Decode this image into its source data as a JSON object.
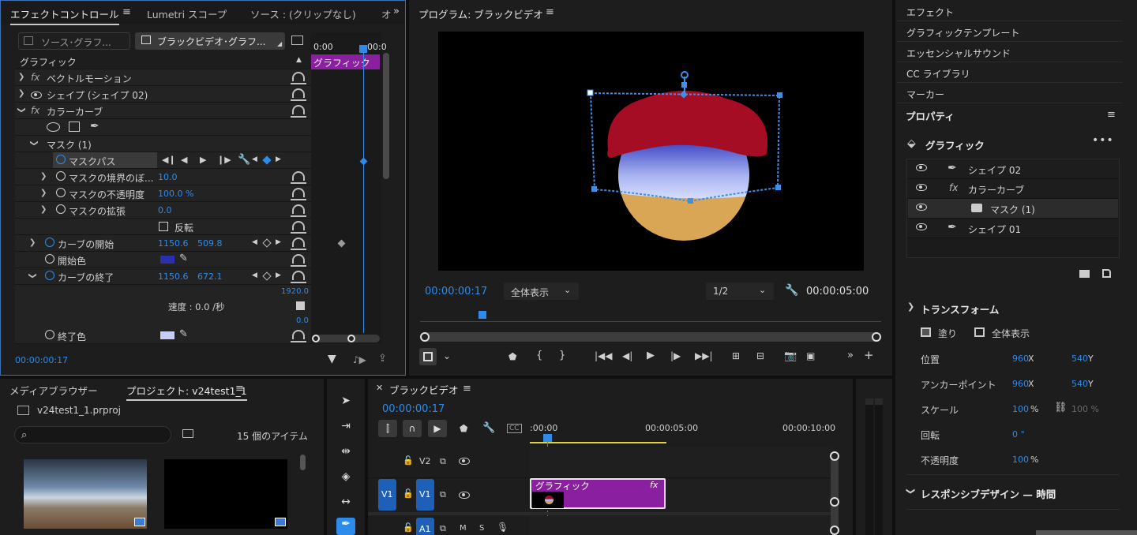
{
  "effect_controls": {
    "tabs": [
      "エフェクトコントロール",
      "Lumetri スコープ",
      "ソース : (クリップなし)"
    ],
    "tab_overflow": "オ",
    "source_master": "ソース･グラフ...",
    "clip_selector": "ブラックビデオ･グラフ...",
    "timeline_ticks": [
      "0:00",
      "00:0"
    ],
    "section": "グラフィック",
    "clip_bar": "グラフィック",
    "rows": {
      "vector_motion": "ベクトルモーション",
      "shape02": "シェイプ (シェイプ 02)",
      "color_curve": "カラーカーブ",
      "mask": "マスク (1)",
      "mask_path": "マスクパス",
      "mask_feather": "マスクの境界のぼ...",
      "mask_feather_val": "10.0",
      "mask_opacity": "マスクの不透明度",
      "mask_opacity_val": "100.0 %",
      "mask_expansion": "マスクの拡張",
      "mask_expansion_val": "0.0",
      "invert": "反転",
      "curve_start": "カーブの開始",
      "curve_start_x": "1150.6",
      "curve_start_y": "509.8",
      "start_color": "開始色",
      "curve_end": "カーブの終了",
      "curve_end_x": "1150.6",
      "curve_end_y": "672.1",
      "graph_max": "1920.0",
      "speed": "速度 : 0.0 /秒",
      "graph_min": "0.0",
      "end_color": "終了色"
    },
    "timecode": "00:00:00:17"
  },
  "program": {
    "title": "プログラム: ブラックビデオ",
    "timecode": "00:00:00:17",
    "zoom": "全体表示",
    "resolution": "1/2",
    "duration": "00:00:05:00"
  },
  "sidebar": {
    "items": [
      "エフェクト",
      "グラフィックテンプレート",
      "エッセンシャルサウンド",
      "CC ライブラリ",
      "マーカー"
    ],
    "properties_title": "プロパティ",
    "graphic_title": "グラフィック",
    "layers": [
      "シェイプ 02",
      "カラーカーブ",
      "マスク (1)",
      "シェイプ 01"
    ],
    "transform_title": "トランスフォーム",
    "fill": "塗り",
    "fit_all": "全体表示",
    "position_label": "位置",
    "position_x": "960",
    "position_y": "540",
    "anchor_label": "アンカーポイント",
    "anchor_x": "960",
    "anchor_y": "540",
    "scale_label": "スケール",
    "scale_val": "100",
    "scale_val2": "100 %",
    "rotation_label": "回転",
    "rotation_val": "0 °",
    "opacity_label": "不透明度",
    "opacity_val": "100",
    "pct": "%",
    "x": "X",
    "y": "Y",
    "responsive": "レスポンシブデザイン — 時間"
  },
  "project": {
    "tabs": [
      "メディアブラウザー",
      "プロジェクト: v24test1_1"
    ],
    "file": "v24test1_1.prproj",
    "item_count": "15 個のアイテム"
  },
  "timeline": {
    "title": "ブラックビデオ",
    "timecode": "00:00:00:17",
    "ruler": [
      ":00:00",
      "00:00:05:00",
      "00:00:10:00"
    ],
    "tracks": [
      "V2",
      "V1",
      "A1"
    ],
    "source_v1": "V1",
    "track_m": "M",
    "track_s": "S",
    "clip_name": "グラフィック",
    "clip_fx": "fx"
  },
  "colors": {
    "accent": "#2d8ceb",
    "clip_purple": "#8a1fa0",
    "shape_red": "#a50d24",
    "shape_gold": "#d9a656",
    "gradient_top": "#3b45c6",
    "gradient_bottom": "#d4dcff"
  }
}
